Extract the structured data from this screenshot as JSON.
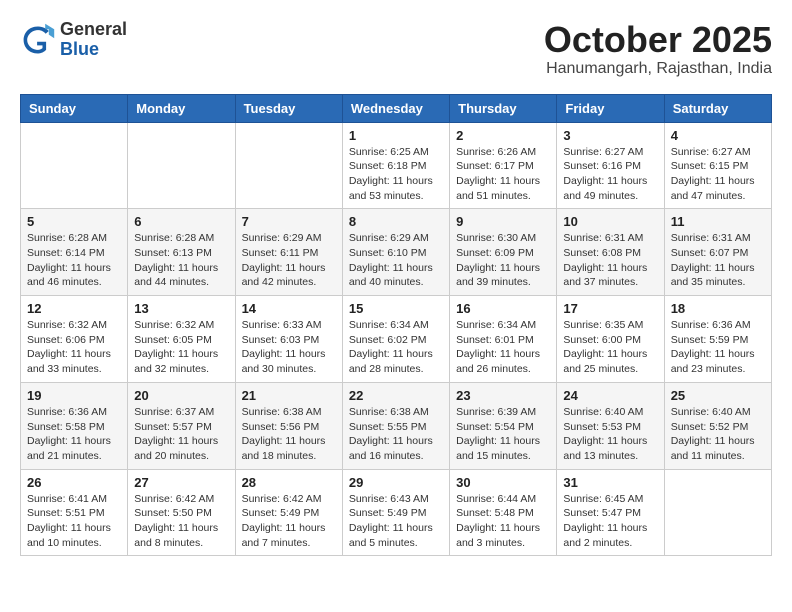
{
  "logo": {
    "general": "General",
    "blue": "Blue"
  },
  "header": {
    "month": "October 2025",
    "location": "Hanumangarh, Rajasthan, India"
  },
  "weekdays": [
    "Sunday",
    "Monday",
    "Tuesday",
    "Wednesday",
    "Thursday",
    "Friday",
    "Saturday"
  ],
  "weeks": [
    [
      {
        "day": "",
        "info": ""
      },
      {
        "day": "",
        "info": ""
      },
      {
        "day": "",
        "info": ""
      },
      {
        "day": "1",
        "info": "Sunrise: 6:25 AM\nSunset: 6:18 PM\nDaylight: 11 hours and 53 minutes."
      },
      {
        "day": "2",
        "info": "Sunrise: 6:26 AM\nSunset: 6:17 PM\nDaylight: 11 hours and 51 minutes."
      },
      {
        "day": "3",
        "info": "Sunrise: 6:27 AM\nSunset: 6:16 PM\nDaylight: 11 hours and 49 minutes."
      },
      {
        "day": "4",
        "info": "Sunrise: 6:27 AM\nSunset: 6:15 PM\nDaylight: 11 hours and 47 minutes."
      }
    ],
    [
      {
        "day": "5",
        "info": "Sunrise: 6:28 AM\nSunset: 6:14 PM\nDaylight: 11 hours and 46 minutes."
      },
      {
        "day": "6",
        "info": "Sunrise: 6:28 AM\nSunset: 6:13 PM\nDaylight: 11 hours and 44 minutes."
      },
      {
        "day": "7",
        "info": "Sunrise: 6:29 AM\nSunset: 6:11 PM\nDaylight: 11 hours and 42 minutes."
      },
      {
        "day": "8",
        "info": "Sunrise: 6:29 AM\nSunset: 6:10 PM\nDaylight: 11 hours and 40 minutes."
      },
      {
        "day": "9",
        "info": "Sunrise: 6:30 AM\nSunset: 6:09 PM\nDaylight: 11 hours and 39 minutes."
      },
      {
        "day": "10",
        "info": "Sunrise: 6:31 AM\nSunset: 6:08 PM\nDaylight: 11 hours and 37 minutes."
      },
      {
        "day": "11",
        "info": "Sunrise: 6:31 AM\nSunset: 6:07 PM\nDaylight: 11 hours and 35 minutes."
      }
    ],
    [
      {
        "day": "12",
        "info": "Sunrise: 6:32 AM\nSunset: 6:06 PM\nDaylight: 11 hours and 33 minutes."
      },
      {
        "day": "13",
        "info": "Sunrise: 6:32 AM\nSunset: 6:05 PM\nDaylight: 11 hours and 32 minutes."
      },
      {
        "day": "14",
        "info": "Sunrise: 6:33 AM\nSunset: 6:03 PM\nDaylight: 11 hours and 30 minutes."
      },
      {
        "day": "15",
        "info": "Sunrise: 6:34 AM\nSunset: 6:02 PM\nDaylight: 11 hours and 28 minutes."
      },
      {
        "day": "16",
        "info": "Sunrise: 6:34 AM\nSunset: 6:01 PM\nDaylight: 11 hours and 26 minutes."
      },
      {
        "day": "17",
        "info": "Sunrise: 6:35 AM\nSunset: 6:00 PM\nDaylight: 11 hours and 25 minutes."
      },
      {
        "day": "18",
        "info": "Sunrise: 6:36 AM\nSunset: 5:59 PM\nDaylight: 11 hours and 23 minutes."
      }
    ],
    [
      {
        "day": "19",
        "info": "Sunrise: 6:36 AM\nSunset: 5:58 PM\nDaylight: 11 hours and 21 minutes."
      },
      {
        "day": "20",
        "info": "Sunrise: 6:37 AM\nSunset: 5:57 PM\nDaylight: 11 hours and 20 minutes."
      },
      {
        "day": "21",
        "info": "Sunrise: 6:38 AM\nSunset: 5:56 PM\nDaylight: 11 hours and 18 minutes."
      },
      {
        "day": "22",
        "info": "Sunrise: 6:38 AM\nSunset: 5:55 PM\nDaylight: 11 hours and 16 minutes."
      },
      {
        "day": "23",
        "info": "Sunrise: 6:39 AM\nSunset: 5:54 PM\nDaylight: 11 hours and 15 minutes."
      },
      {
        "day": "24",
        "info": "Sunrise: 6:40 AM\nSunset: 5:53 PM\nDaylight: 11 hours and 13 minutes."
      },
      {
        "day": "25",
        "info": "Sunrise: 6:40 AM\nSunset: 5:52 PM\nDaylight: 11 hours and 11 minutes."
      }
    ],
    [
      {
        "day": "26",
        "info": "Sunrise: 6:41 AM\nSunset: 5:51 PM\nDaylight: 11 hours and 10 minutes."
      },
      {
        "day": "27",
        "info": "Sunrise: 6:42 AM\nSunset: 5:50 PM\nDaylight: 11 hours and 8 minutes."
      },
      {
        "day": "28",
        "info": "Sunrise: 6:42 AM\nSunset: 5:49 PM\nDaylight: 11 hours and 7 minutes."
      },
      {
        "day": "29",
        "info": "Sunrise: 6:43 AM\nSunset: 5:49 PM\nDaylight: 11 hours and 5 minutes."
      },
      {
        "day": "30",
        "info": "Sunrise: 6:44 AM\nSunset: 5:48 PM\nDaylight: 11 hours and 3 minutes."
      },
      {
        "day": "31",
        "info": "Sunrise: 6:45 AM\nSunset: 5:47 PM\nDaylight: 11 hours and 2 minutes."
      },
      {
        "day": "",
        "info": ""
      }
    ]
  ]
}
